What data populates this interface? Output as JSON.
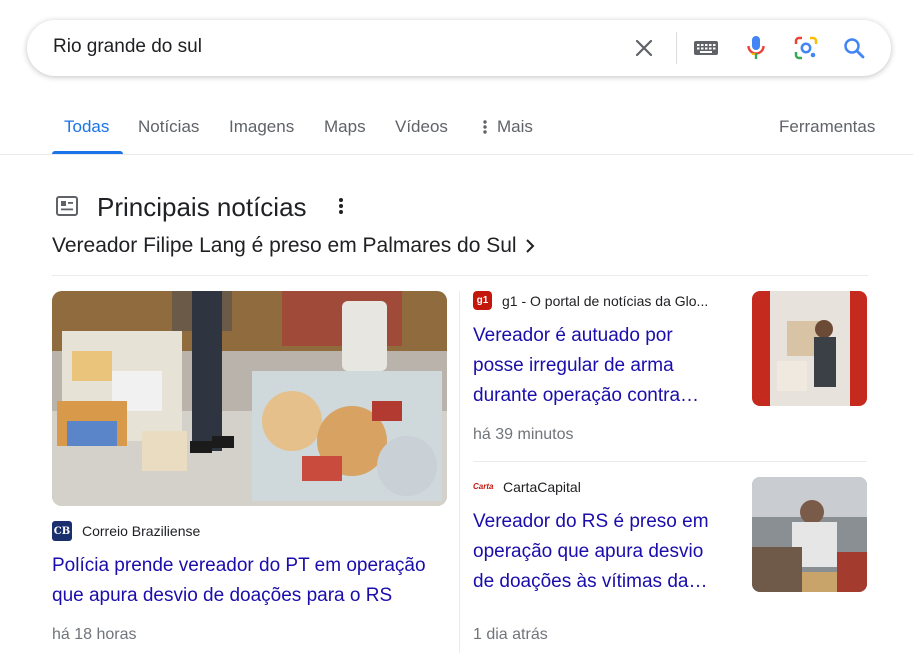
{
  "search": {
    "query": "Rio grande do sul"
  },
  "tabs": [
    {
      "label": "Todas",
      "active": true
    },
    {
      "label": "Notícias"
    },
    {
      "label": "Imagens"
    },
    {
      "label": "Maps"
    },
    {
      "label": "Vídeos"
    },
    {
      "label": "Mais"
    }
  ],
  "tools_label": "Ferramentas",
  "top_stories": {
    "title": "Principais notícias",
    "story_link": "Vereador Filipe Lang é preso em Palmares do Sul",
    "main_card": {
      "source": "Correio Braziliense",
      "logo_text": "CB",
      "headline_line1": "Polícia prende vereador do PT em operação",
      "headline_line2": "que apura desvio de doações para o RS",
      "time": "há 18 horas"
    },
    "card2": {
      "source": "g1 - O portal de notícias da Glo...",
      "logo_text": "g1",
      "headline_line1": "Vereador é autuado por",
      "headline_line2": "posse irregular de arma",
      "headline_line3": "durante operação contra…",
      "time": "há 39 minutos"
    },
    "card3": {
      "source": "CartaCapital",
      "logo_text": "Carta",
      "headline_line1": "Vereador do RS é preso em",
      "headline_line2": "operação que apura desvio",
      "headline_line3": "de doações às vítimas da…",
      "time": "1 dia atrás"
    }
  },
  "colors": {
    "link": "#1a0dab",
    "accent": "#1a73e8",
    "meta": "#70757a"
  }
}
